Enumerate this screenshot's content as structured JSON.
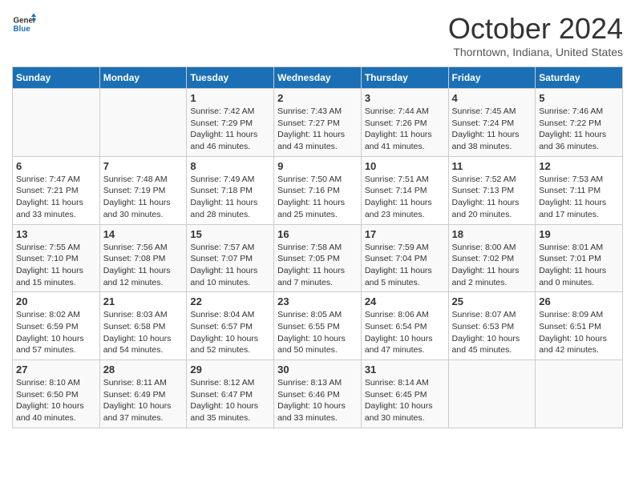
{
  "header": {
    "logo_general": "General",
    "logo_blue": "Blue",
    "month": "October 2024",
    "location": "Thorntown, Indiana, United States"
  },
  "days_of_week": [
    "Sunday",
    "Monday",
    "Tuesday",
    "Wednesday",
    "Thursday",
    "Friday",
    "Saturday"
  ],
  "weeks": [
    [
      {
        "day": "",
        "sunrise": "",
        "sunset": "",
        "daylight": ""
      },
      {
        "day": "",
        "sunrise": "",
        "sunset": "",
        "daylight": ""
      },
      {
        "day": "1",
        "sunrise": "Sunrise: 7:42 AM",
        "sunset": "Sunset: 7:29 PM",
        "daylight": "Daylight: 11 hours and 46 minutes."
      },
      {
        "day": "2",
        "sunrise": "Sunrise: 7:43 AM",
        "sunset": "Sunset: 7:27 PM",
        "daylight": "Daylight: 11 hours and 43 minutes."
      },
      {
        "day": "3",
        "sunrise": "Sunrise: 7:44 AM",
        "sunset": "Sunset: 7:26 PM",
        "daylight": "Daylight: 11 hours and 41 minutes."
      },
      {
        "day": "4",
        "sunrise": "Sunrise: 7:45 AM",
        "sunset": "Sunset: 7:24 PM",
        "daylight": "Daylight: 11 hours and 38 minutes."
      },
      {
        "day": "5",
        "sunrise": "Sunrise: 7:46 AM",
        "sunset": "Sunset: 7:22 PM",
        "daylight": "Daylight: 11 hours and 36 minutes."
      }
    ],
    [
      {
        "day": "6",
        "sunrise": "Sunrise: 7:47 AM",
        "sunset": "Sunset: 7:21 PM",
        "daylight": "Daylight: 11 hours and 33 minutes."
      },
      {
        "day": "7",
        "sunrise": "Sunrise: 7:48 AM",
        "sunset": "Sunset: 7:19 PM",
        "daylight": "Daylight: 11 hours and 30 minutes."
      },
      {
        "day": "8",
        "sunrise": "Sunrise: 7:49 AM",
        "sunset": "Sunset: 7:18 PM",
        "daylight": "Daylight: 11 hours and 28 minutes."
      },
      {
        "day": "9",
        "sunrise": "Sunrise: 7:50 AM",
        "sunset": "Sunset: 7:16 PM",
        "daylight": "Daylight: 11 hours and 25 minutes."
      },
      {
        "day": "10",
        "sunrise": "Sunrise: 7:51 AM",
        "sunset": "Sunset: 7:14 PM",
        "daylight": "Daylight: 11 hours and 23 minutes."
      },
      {
        "day": "11",
        "sunrise": "Sunrise: 7:52 AM",
        "sunset": "Sunset: 7:13 PM",
        "daylight": "Daylight: 11 hours and 20 minutes."
      },
      {
        "day": "12",
        "sunrise": "Sunrise: 7:53 AM",
        "sunset": "Sunset: 7:11 PM",
        "daylight": "Daylight: 11 hours and 17 minutes."
      }
    ],
    [
      {
        "day": "13",
        "sunrise": "Sunrise: 7:55 AM",
        "sunset": "Sunset: 7:10 PM",
        "daylight": "Daylight: 11 hours and 15 minutes."
      },
      {
        "day": "14",
        "sunrise": "Sunrise: 7:56 AM",
        "sunset": "Sunset: 7:08 PM",
        "daylight": "Daylight: 11 hours and 12 minutes."
      },
      {
        "day": "15",
        "sunrise": "Sunrise: 7:57 AM",
        "sunset": "Sunset: 7:07 PM",
        "daylight": "Daylight: 11 hours and 10 minutes."
      },
      {
        "day": "16",
        "sunrise": "Sunrise: 7:58 AM",
        "sunset": "Sunset: 7:05 PM",
        "daylight": "Daylight: 11 hours and 7 minutes."
      },
      {
        "day": "17",
        "sunrise": "Sunrise: 7:59 AM",
        "sunset": "Sunset: 7:04 PM",
        "daylight": "Daylight: 11 hours and 5 minutes."
      },
      {
        "day": "18",
        "sunrise": "Sunrise: 8:00 AM",
        "sunset": "Sunset: 7:02 PM",
        "daylight": "Daylight: 11 hours and 2 minutes."
      },
      {
        "day": "19",
        "sunrise": "Sunrise: 8:01 AM",
        "sunset": "Sunset: 7:01 PM",
        "daylight": "Daylight: 11 hours and 0 minutes."
      }
    ],
    [
      {
        "day": "20",
        "sunrise": "Sunrise: 8:02 AM",
        "sunset": "Sunset: 6:59 PM",
        "daylight": "Daylight: 10 hours and 57 minutes."
      },
      {
        "day": "21",
        "sunrise": "Sunrise: 8:03 AM",
        "sunset": "Sunset: 6:58 PM",
        "daylight": "Daylight: 10 hours and 54 minutes."
      },
      {
        "day": "22",
        "sunrise": "Sunrise: 8:04 AM",
        "sunset": "Sunset: 6:57 PM",
        "daylight": "Daylight: 10 hours and 52 minutes."
      },
      {
        "day": "23",
        "sunrise": "Sunrise: 8:05 AM",
        "sunset": "Sunset: 6:55 PM",
        "daylight": "Daylight: 10 hours and 50 minutes."
      },
      {
        "day": "24",
        "sunrise": "Sunrise: 8:06 AM",
        "sunset": "Sunset: 6:54 PM",
        "daylight": "Daylight: 10 hours and 47 minutes."
      },
      {
        "day": "25",
        "sunrise": "Sunrise: 8:07 AM",
        "sunset": "Sunset: 6:53 PM",
        "daylight": "Daylight: 10 hours and 45 minutes."
      },
      {
        "day": "26",
        "sunrise": "Sunrise: 8:09 AM",
        "sunset": "Sunset: 6:51 PM",
        "daylight": "Daylight: 10 hours and 42 minutes."
      }
    ],
    [
      {
        "day": "27",
        "sunrise": "Sunrise: 8:10 AM",
        "sunset": "Sunset: 6:50 PM",
        "daylight": "Daylight: 10 hours and 40 minutes."
      },
      {
        "day": "28",
        "sunrise": "Sunrise: 8:11 AM",
        "sunset": "Sunset: 6:49 PM",
        "daylight": "Daylight: 10 hours and 37 minutes."
      },
      {
        "day": "29",
        "sunrise": "Sunrise: 8:12 AM",
        "sunset": "Sunset: 6:47 PM",
        "daylight": "Daylight: 10 hours and 35 minutes."
      },
      {
        "day": "30",
        "sunrise": "Sunrise: 8:13 AM",
        "sunset": "Sunset: 6:46 PM",
        "daylight": "Daylight: 10 hours and 33 minutes."
      },
      {
        "day": "31",
        "sunrise": "Sunrise: 8:14 AM",
        "sunset": "Sunset: 6:45 PM",
        "daylight": "Daylight: 10 hours and 30 minutes."
      },
      {
        "day": "",
        "sunrise": "",
        "sunset": "",
        "daylight": ""
      },
      {
        "day": "",
        "sunrise": "",
        "sunset": "",
        "daylight": ""
      }
    ]
  ]
}
